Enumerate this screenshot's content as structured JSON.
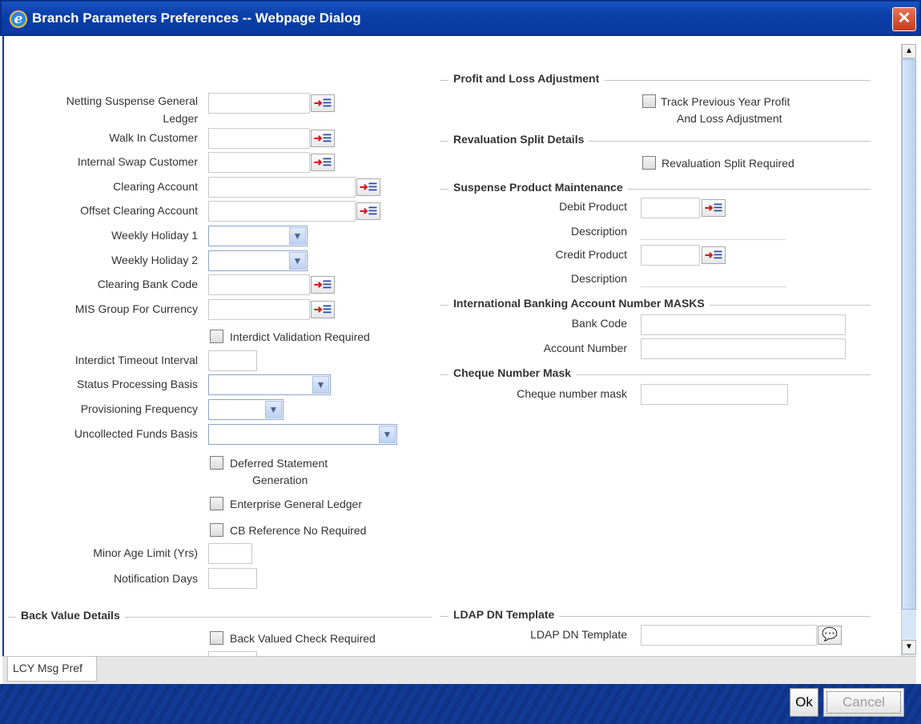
{
  "window": {
    "title": "Branch Parameters Preferences -- Webpage Dialog",
    "close_glyph": "✕",
    "app_icon_glyph": "e"
  },
  "left": {
    "netting_suspense_gl": {
      "label_line1": "Netting Suspense General",
      "label_line2": "Ledger",
      "value": ""
    },
    "walk_in_customer": {
      "label": "Walk In Customer",
      "value": ""
    },
    "internal_swap_customer": {
      "label": "Internal Swap Customer",
      "value": ""
    },
    "clearing_account": {
      "label": "Clearing Account",
      "value": ""
    },
    "offset_clearing_account": {
      "label": "Offset Clearing Account",
      "value": ""
    },
    "weekly_holiday_1": {
      "label": "Weekly Holiday 1",
      "value": ""
    },
    "weekly_holiday_2": {
      "label": "Weekly Holiday 2",
      "value": ""
    },
    "clearing_bank_code": {
      "label": "Clearing Bank Code",
      "value": ""
    },
    "mis_group_for_currency": {
      "label": "MIS Group For Currency",
      "value": ""
    },
    "interdict_validation_required": {
      "label": "Interdict Validation Required",
      "checked": false
    },
    "interdict_timeout_interval": {
      "label": "Interdict Timeout Interval",
      "value": ""
    },
    "status_processing_basis": {
      "label": "Status Processing Basis",
      "value": ""
    },
    "provisioning_frequency": {
      "label": "Provisioning Frequency",
      "value": ""
    },
    "uncollected_funds_basis": {
      "label": "Uncollected Funds Basis",
      "value": ""
    },
    "deferred_statement_generation": {
      "label_line1": "Deferred Statement",
      "label_line2": "Generation",
      "checked": false
    },
    "enterprise_general_ledger": {
      "label": "Enterprise General Ledger",
      "checked": false
    },
    "cb_reference_no_required": {
      "label": "CB Reference No Required",
      "checked": false
    },
    "minor_age_limit": {
      "label": "Minor Age Limit (Yrs)",
      "value": ""
    },
    "notification_days": {
      "label": "Notification Days",
      "value": ""
    }
  },
  "back_value": {
    "section_title": "Back Value Details",
    "back_valued_check_required": {
      "label": "Back Valued Check Required",
      "checked": false
    }
  },
  "right": {
    "pl_adjustment": {
      "section_title": "Profit and Loss Adjustment",
      "track_prev_year": {
        "label_line1": "Track Previous Year Profit",
        "label_line2": "And Loss Adjustment",
        "checked": false
      }
    },
    "revaluation_split": {
      "section_title": "Revaluation Split Details",
      "required": {
        "label": "Revaluation Split Required",
        "checked": false
      }
    },
    "suspense_product": {
      "section_title": "Suspense Product Maintenance",
      "debit_product": {
        "label": "Debit Product",
        "value": ""
      },
      "debit_description": {
        "label": "Description",
        "value": ""
      },
      "credit_product": {
        "label": "Credit Product",
        "value": ""
      },
      "credit_description": {
        "label": "Description",
        "value": ""
      }
    },
    "iban_masks": {
      "section_title": "International Banking Account Number MASKS",
      "bank_code": {
        "label": "Bank Code",
        "value": ""
      },
      "account_number": {
        "label": "Account Number",
        "value": ""
      }
    },
    "cheque_mask": {
      "section_title": "Cheque Number Mask",
      "cheque_number_mask": {
        "label": "Cheque number mask",
        "value": ""
      }
    },
    "ldap": {
      "section_title": "LDAP DN Template",
      "template": {
        "label": "LDAP DN Template",
        "value": ""
      }
    }
  },
  "icons": {
    "lov_arrow": "➜",
    "lov_lines": "☰",
    "dropdown": "▼",
    "ldap_glyph": "💬",
    "scroll_up": "▲",
    "scroll_down": "▼"
  },
  "tabs": [
    {
      "label": "LCY Msg Pref"
    }
  ],
  "buttons": {
    "ok": "Ok",
    "cancel": "Cancel"
  },
  "colors": {
    "titlebar": "#0a3fa8",
    "footer": "#0f3386",
    "close": "#c83a18"
  }
}
